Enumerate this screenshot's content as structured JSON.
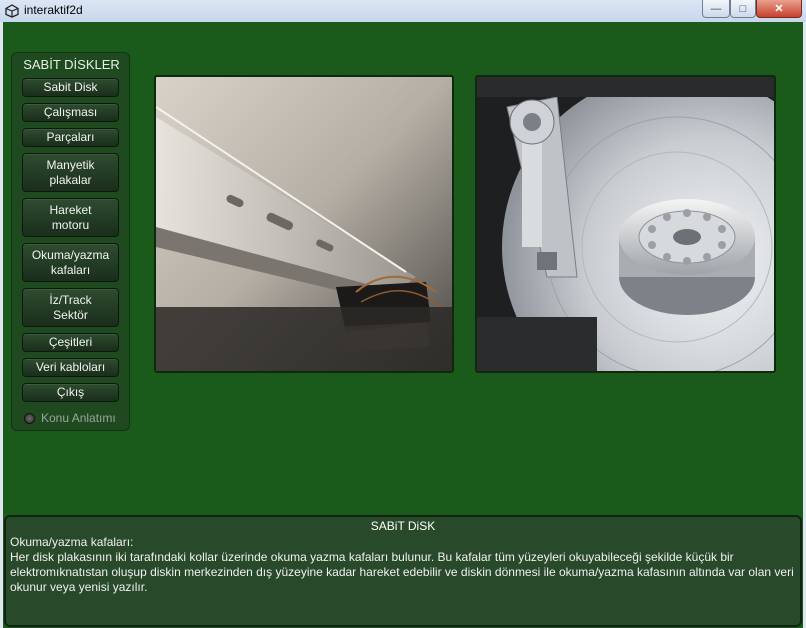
{
  "window": {
    "title": "interaktif2d",
    "minimize_label": "—",
    "maximize_label": "□",
    "close_label": "✕"
  },
  "sidebar": {
    "title": "SABİT DİSKLER",
    "items": [
      {
        "label": "Sabit Disk"
      },
      {
        "label": "Çalışması"
      },
      {
        "label": "Parçaları"
      },
      {
        "label": "Manyetik\nplakalar"
      },
      {
        "label": "Hareket\nmotoru"
      },
      {
        "label": "Okuma/yazma\nkafaları"
      },
      {
        "label": "İz/Track\nSektör"
      },
      {
        "label": "Çeşitleri"
      },
      {
        "label": "Veri kabloları"
      },
      {
        "label": "Çıkış"
      }
    ],
    "radio_label": "Konu Anlatımı"
  },
  "info_panel": {
    "title": "SABiT DiSK",
    "subtitle": "Okuma/yazma kafaları:",
    "body": "Her disk plakasının iki tarafındaki kollar üzerinde okuma yazma kafaları bulunur. Bu kafalar tüm yüzeyleri okuyabileceği şekilde küçük bir elektromıknatıstan oluşup diskin merkezinden dış yüzeyine kadar hareket edebilir ve diskin dönmesi ile okuma/yazma kafasının altında var olan veri okunur veya yenisi yazılır."
  },
  "colors": {
    "background": "#1a5a1a",
    "sidebar": "#1f4a20",
    "panel": "#294a2a"
  }
}
